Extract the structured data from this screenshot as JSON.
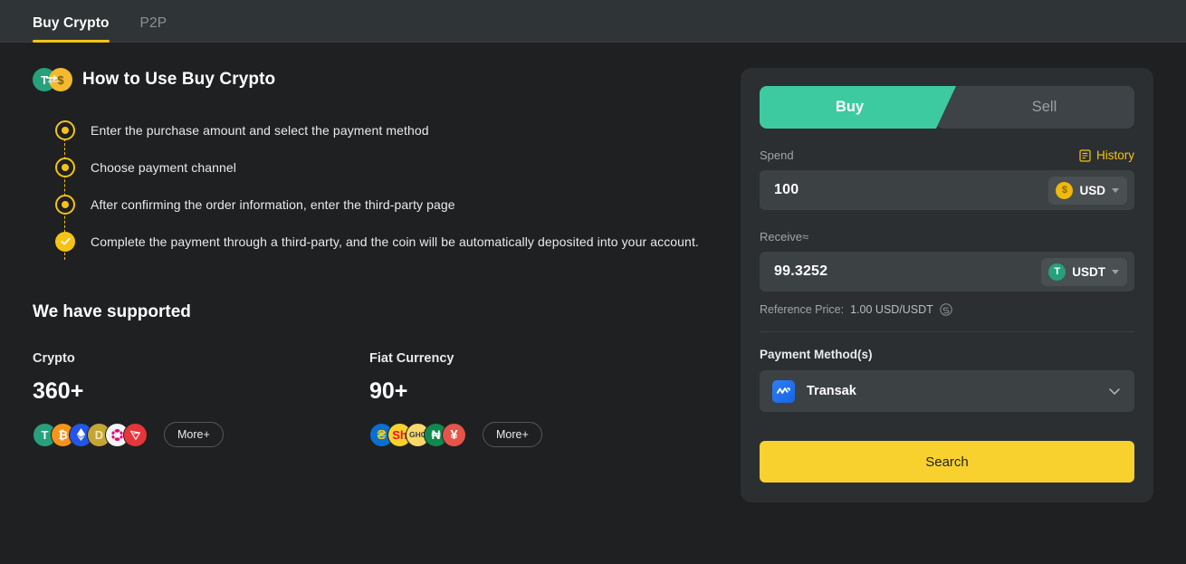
{
  "topbar": {
    "tabs": [
      {
        "label": "Buy Crypto",
        "active": true
      },
      {
        "label": "P2P",
        "active": false
      }
    ]
  },
  "howto": {
    "icon": "swap-coins-icon",
    "title": "How to Use Buy Crypto",
    "steps": [
      {
        "text": "Enter the purchase amount and select the payment method",
        "state": "pending"
      },
      {
        "text": "Choose payment channel",
        "state": "pending"
      },
      {
        "text": "After confirming the order information, enter the third-party page",
        "state": "pending"
      },
      {
        "text": "Complete the payment through a third-party, and the coin will be automatically deposited into your account.",
        "state": "done"
      }
    ]
  },
  "supported": {
    "title": "We have supported",
    "columns": [
      {
        "label": "Crypto",
        "count": "360+",
        "more_label": "More+",
        "coins": [
          {
            "symbol": "T",
            "name": "tether-icon",
            "color": "#26a17b",
            "text": "#ffffff"
          },
          {
            "symbol": "₿",
            "name": "bitcoin-icon",
            "color": "#f7931a",
            "text": "#ffffff"
          },
          {
            "symbol": "◇",
            "name": "ethereum-icon",
            "color": "#2356e8",
            "text": "#ffffff"
          },
          {
            "symbol": "D",
            "name": "dogecoin-icon",
            "color": "#c3a634",
            "text": "#f5e7bc"
          },
          {
            "symbol": "⬤",
            "name": "polkadot-icon",
            "color": "#f5f5f5",
            "text": "#e6007a"
          },
          {
            "symbol": "▽",
            "name": "tron-icon",
            "color": "#e6353b",
            "text": "#ffffff"
          }
        ]
      },
      {
        "label": "Fiat Currency",
        "count": "90+",
        "more_label": "More+",
        "coins": [
          {
            "symbol": "₴",
            "name": "uah-icon",
            "color": "#0b6ed2",
            "text": "#f5d400"
          },
          {
            "symbol": "Sh",
            "name": "shilling-icon",
            "color": "#f8d12f",
            "text": "#e0162b"
          },
          {
            "symbol": "GHC",
            "name": "ghc-icon",
            "color": "#f8d96a",
            "text": "#3c3c3c"
          },
          {
            "symbol": "₦",
            "name": "ngn-icon",
            "color": "#11884f",
            "text": "#ffffff"
          },
          {
            "symbol": "¥",
            "name": "yen-icon",
            "color": "#e55349",
            "text": "#ffffff"
          }
        ]
      }
    ]
  },
  "panel": {
    "side_tabs": [
      {
        "label": "Buy",
        "active": true
      },
      {
        "label": "Sell",
        "active": false
      }
    ],
    "spend": {
      "label": "Spend",
      "history_label": "History",
      "history_icon": "document-list-icon",
      "value": "100",
      "currency": "USD",
      "currency_icon": "usd-coin-icon"
    },
    "receive": {
      "label": "Receive≈",
      "value": "99.3252",
      "currency": "USDT",
      "currency_icon": "usdt-coin-icon"
    },
    "reference": {
      "label": "Reference Price:",
      "value": "1.00 USD/USDT",
      "refresh_icon": "swap-refresh-icon"
    },
    "payment": {
      "label": "Payment Method(s)",
      "selected": "Transak",
      "logo_icon": "transak-logo-icon",
      "chevron_icon": "chevron-down-icon"
    },
    "submit_label": "Search"
  },
  "colors": {
    "accent_yellow": "#f8d12f",
    "buy_green": "#3ecaa0",
    "page_bg": "#1e2022",
    "panel_bg": "#2b2f31",
    "input_bg": "#3c4144"
  }
}
